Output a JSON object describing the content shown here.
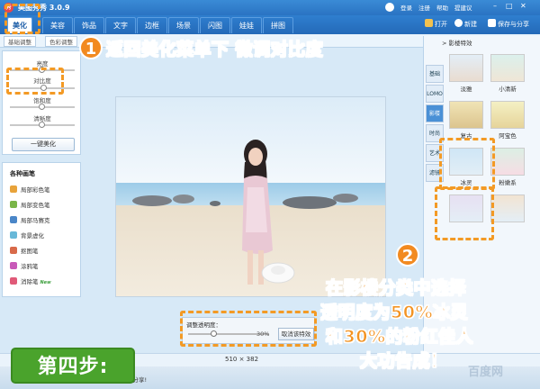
{
  "app": {
    "title": "美图秀秀 3.0.9",
    "logo_text": "秀"
  },
  "topright": {
    "login": "登录",
    "register": "注册",
    "help": "帮助",
    "feedback": "提建议"
  },
  "tabs": [
    "美化",
    "美容",
    "饰品",
    "文字",
    "边框",
    "场景",
    "闪图",
    "娃娃",
    "拼图"
  ],
  "toolbar": {
    "open": "打开",
    "new": "新建",
    "save_share": "保存与分享"
  },
  "subtabs": {
    "basic": "基础调整",
    "color": "色彩调整"
  },
  "leftpanel": {
    "brightness": "亮度",
    "contrast": "对比度",
    "saturation": "饱和度",
    "sharpness": "清晰度",
    "onekey": "一键美化"
  },
  "brushes": {
    "title": "各种画笔",
    "items": [
      {
        "label": "局部彩色笔",
        "color": "#e8a33a"
      },
      {
        "label": "局部变色笔",
        "color": "#7ab648"
      },
      {
        "label": "局部马赛克",
        "color": "#4a86c8"
      },
      {
        "label": "背景虚化",
        "color": "#68b8d8"
      },
      {
        "label": "抠图笔",
        "color": "#d86a4a"
      },
      {
        "label": "涂鸦笔",
        "color": "#c85ab8"
      },
      {
        "label": "消除笔",
        "color": "#e05a78"
      }
    ],
    "new_tag": "New"
  },
  "image": {
    "dimensions": "510 × 382"
  },
  "transparency": {
    "label": "调整透明度：",
    "value": "30%",
    "cancel": "取消该特效"
  },
  "status": {
    "text": "定立即分享!"
  },
  "rightpanel": {
    "header": "> 影楼特效",
    "categories": [
      "基础",
      "LOMO",
      "影楼",
      "时尚",
      "艺术",
      "滤镜"
    ],
    "effects": [
      "淡雅",
      "小清新",
      "复古",
      "阿宝色",
      "冰灵",
      "粉嫩系",
      "",
      ""
    ]
  },
  "annotations": {
    "step1_num": "1",
    "step1_text": "返回美化菜单下 微调对比度",
    "step2_num": "2",
    "step2_line1": "在影楼分类中选择",
    "step2_line2": "透明度为50%冰灵",
    "step2_line3": "和30%的粉红佳人",
    "step2_line4": "大功告成！",
    "step_label": "第四步:"
  },
  "watermark": "百度网"
}
